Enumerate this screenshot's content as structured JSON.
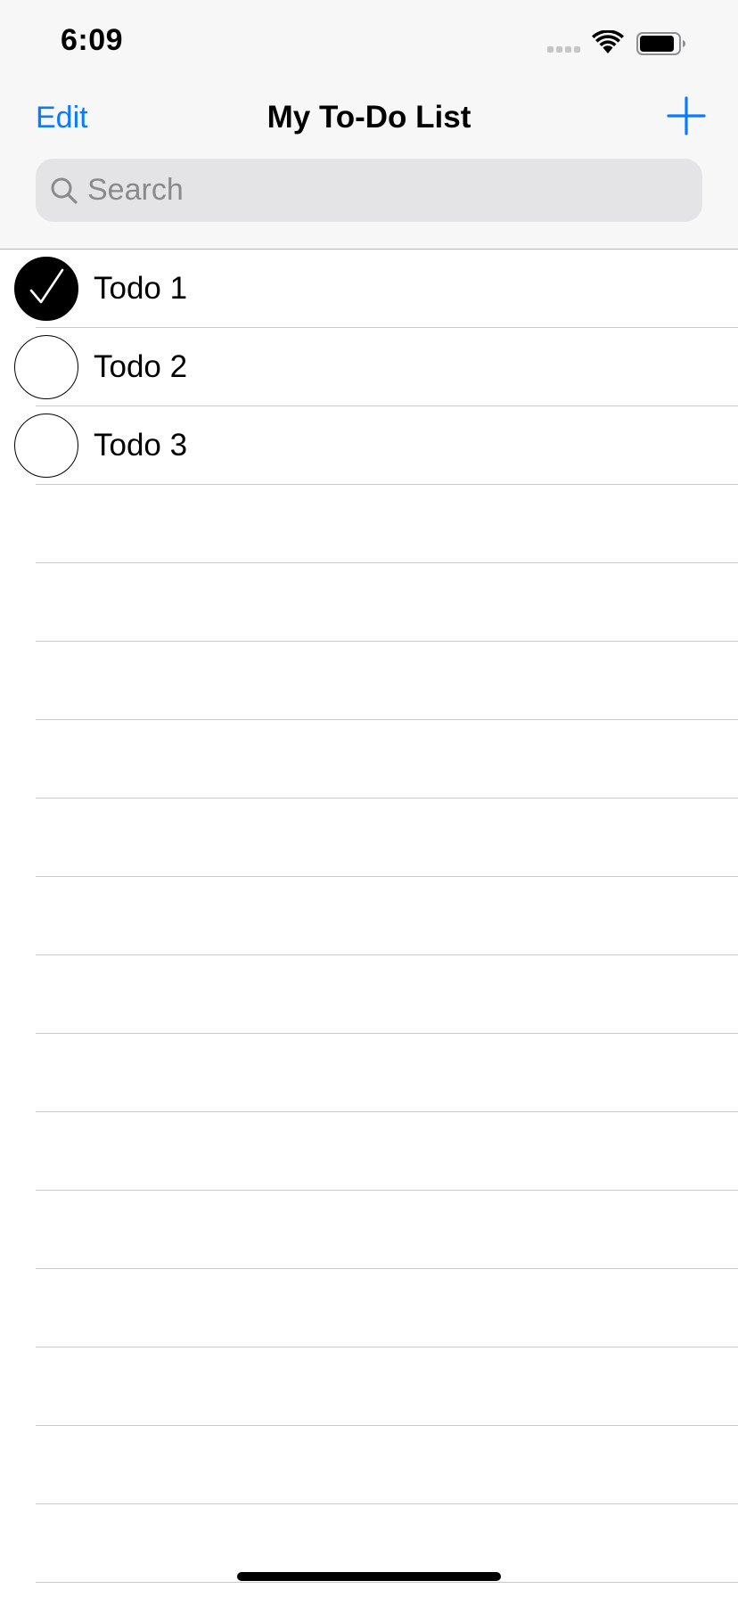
{
  "status_bar": {
    "time": "6:09",
    "icons": [
      "signal-icon",
      "wifi-icon",
      "battery-icon"
    ]
  },
  "nav": {
    "edit_label": "Edit",
    "title": "My To-Do List",
    "add_icon": "plus-icon"
  },
  "search": {
    "placeholder": "Search",
    "value": "",
    "icon": "search-icon"
  },
  "todos": [
    {
      "label": "Todo 1",
      "done": true
    },
    {
      "label": "Todo 2",
      "done": false
    },
    {
      "label": "Todo 3",
      "done": false
    }
  ],
  "colors": {
    "accent": "#0a7aff",
    "nav_background": "#f7f7f7",
    "search_background": "#e4e4e6",
    "separator": "#c8c7cc",
    "check_fill": "#000000"
  }
}
